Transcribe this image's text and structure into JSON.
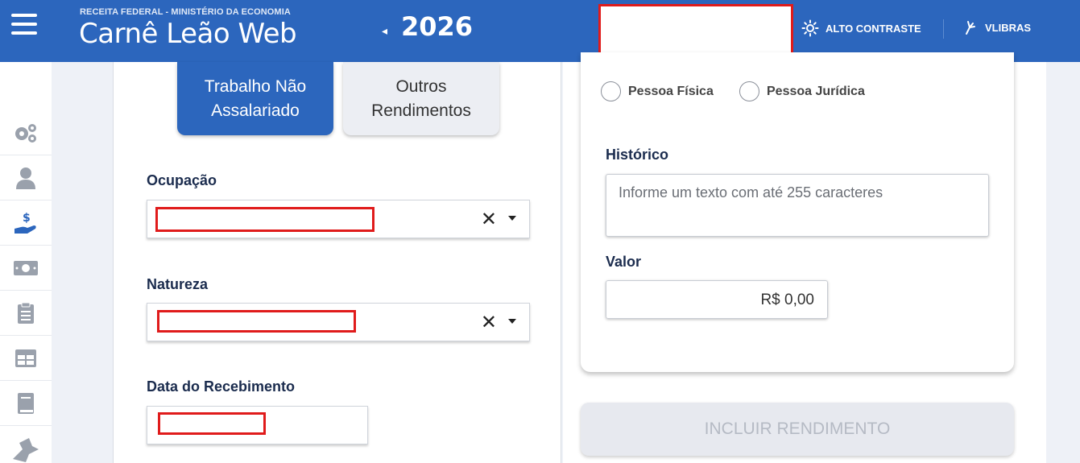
{
  "header": {
    "agency": "RECEITA FEDERAL - MINISTÉRIO DA ECONOMIA",
    "app_title": "Carnê Leão Web",
    "year_prev_icon": "◂",
    "year": "2026",
    "contrast_label": "ALTO CONTRASTE",
    "libras_label": "VLIBRAS",
    "brand_color": "#2c66bd",
    "redaction_color": "#e01b1b"
  },
  "sidebar": {
    "items": [
      {
        "icon": "gears-icon"
      },
      {
        "icon": "user-icon"
      },
      {
        "icon": "hand-money-icon"
      },
      {
        "icon": "banknote-icon"
      },
      {
        "icon": "clipboard-icon"
      },
      {
        "icon": "table-icon"
      },
      {
        "icon": "book-icon"
      },
      {
        "icon": "pin-arrow-icon"
      }
    ]
  },
  "tabs": {
    "active_line1": "Trabalho Não",
    "active_line2": "Assalariado",
    "inactive_line1": "Outros",
    "inactive_line2": "Rendimentos"
  },
  "form": {
    "ocupacao_label": "Ocupação",
    "natureza_label": "Natureza",
    "data_label": "Data do Recebimento",
    "clear_icon": "✕"
  },
  "right": {
    "radio_pf": "Pessoa Física",
    "radio_pj": "Pessoa Jurídica",
    "historico_label": "Histórico",
    "historico_placeholder": "Informe um texto com até 255 caracteres",
    "valor_label": "Valor",
    "valor_value": "R$ 0,00",
    "incluir_label": "INCLUIR RENDIMENTO"
  }
}
